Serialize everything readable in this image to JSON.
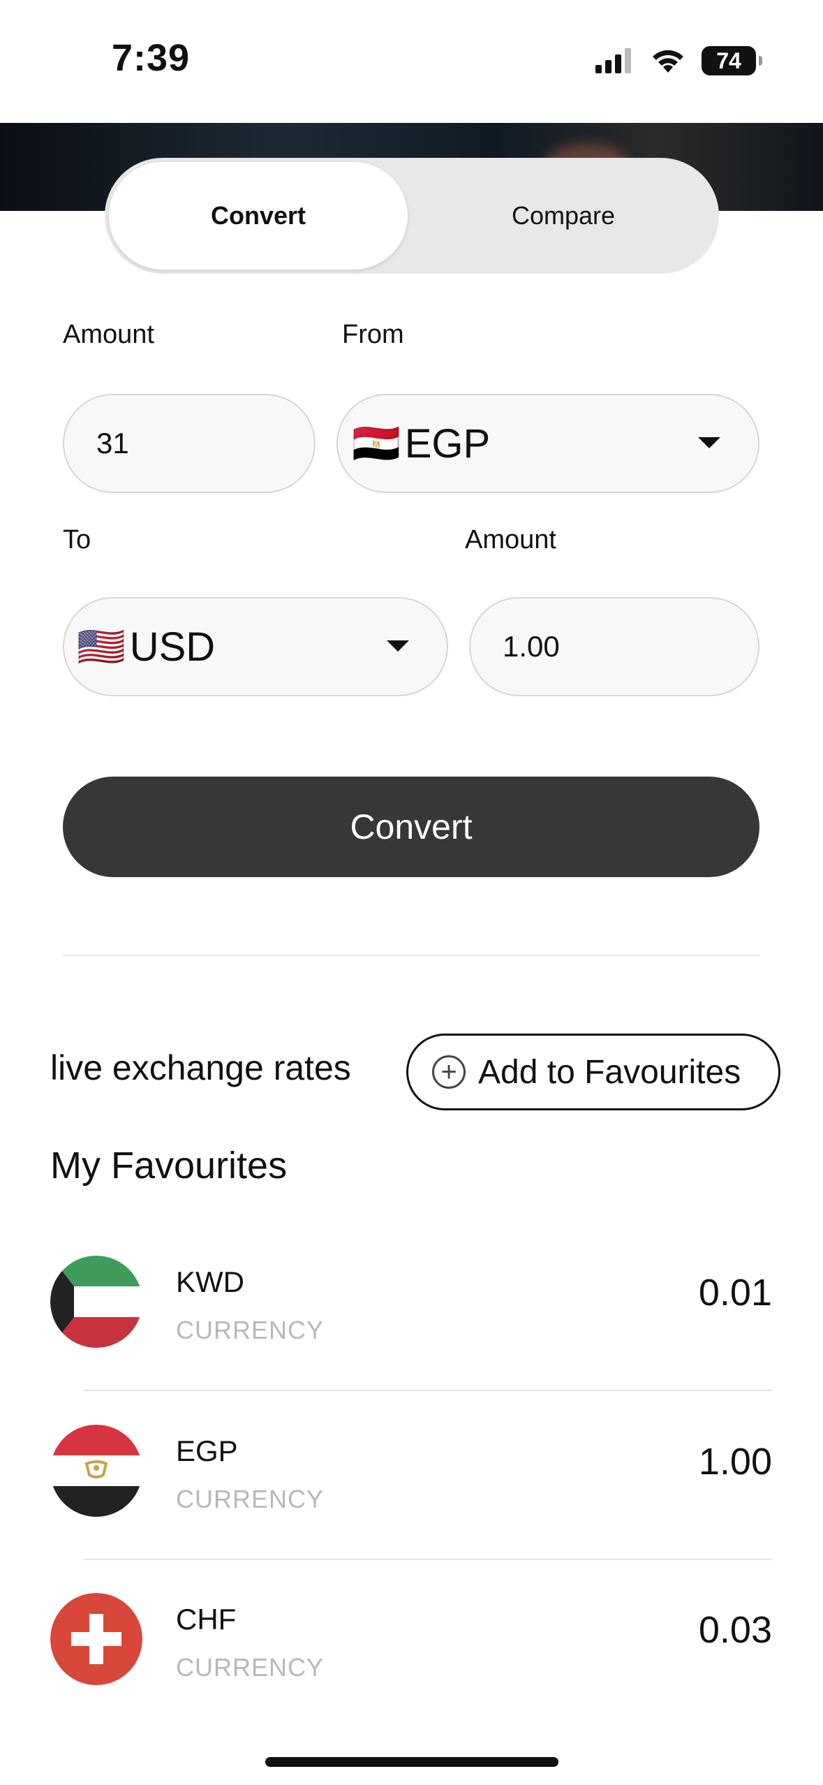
{
  "status": {
    "time": "7:39",
    "battery": "74"
  },
  "tabs": {
    "convert": "Convert",
    "compare": "Compare"
  },
  "form": {
    "amount_label": "Amount",
    "from_label": "From",
    "amount_value": "31",
    "from_flag": "🇪🇬",
    "from_code": "EGP",
    "to_label": "To",
    "to_amount_label": "Amount",
    "to_flag": "🇺🇸",
    "to_code": "USD",
    "to_amount_value": "1.00"
  },
  "convert_button": "Convert",
  "live_rates_label": "live exchange rates",
  "add_favourites": "Add to Favourites",
  "favourites_title": "My Favourites",
  "favourites": [
    {
      "code": "KWD",
      "sub": "CURRENCY",
      "rate": "0.01"
    },
    {
      "code": "EGP",
      "sub": "CURRENCY",
      "rate": "1.00"
    },
    {
      "code": "CHF",
      "sub": "CURRENCY",
      "rate": "0.03"
    }
  ]
}
